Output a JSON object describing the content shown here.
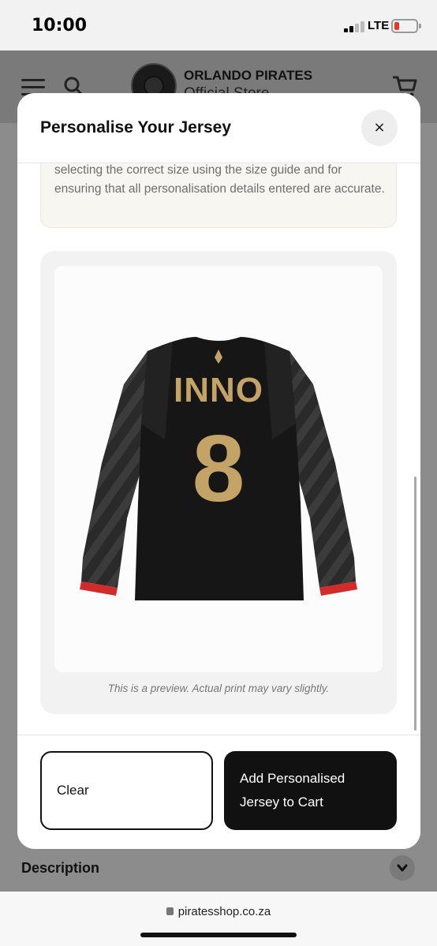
{
  "status_bar": {
    "time": "10:00",
    "network": "LTE"
  },
  "site_header": {
    "brand_name": "ORLANDO PIRATES",
    "brand_subtitle": "Official Store"
  },
  "modal": {
    "title": "Personalise Your Jersey",
    "close_label": "×",
    "notice_text": "selecting the correct size using the size guide and for ensuring that all personalisation details entered are accurate.",
    "preview": {
      "name_print": "INNO",
      "number_print": "8",
      "caption": "This is a preview. Actual print may vary slightly."
    },
    "clear_label": "Clear",
    "add_label": "Add Personalised Jersey to Cart"
  },
  "page": {
    "description_label": "Description"
  },
  "browser": {
    "url": "piratesshop.co.za"
  },
  "colors": {
    "accent": "#111111",
    "print_gold": "#c4a366",
    "cuff_red": "#d42a2a",
    "notice_bg": "#f8f6f0"
  },
  "icons": [
    "hamburger-icon",
    "search-icon",
    "cart-icon",
    "close-icon",
    "chevron-down-icon",
    "lock-icon",
    "signal-icon",
    "battery-icon"
  ]
}
